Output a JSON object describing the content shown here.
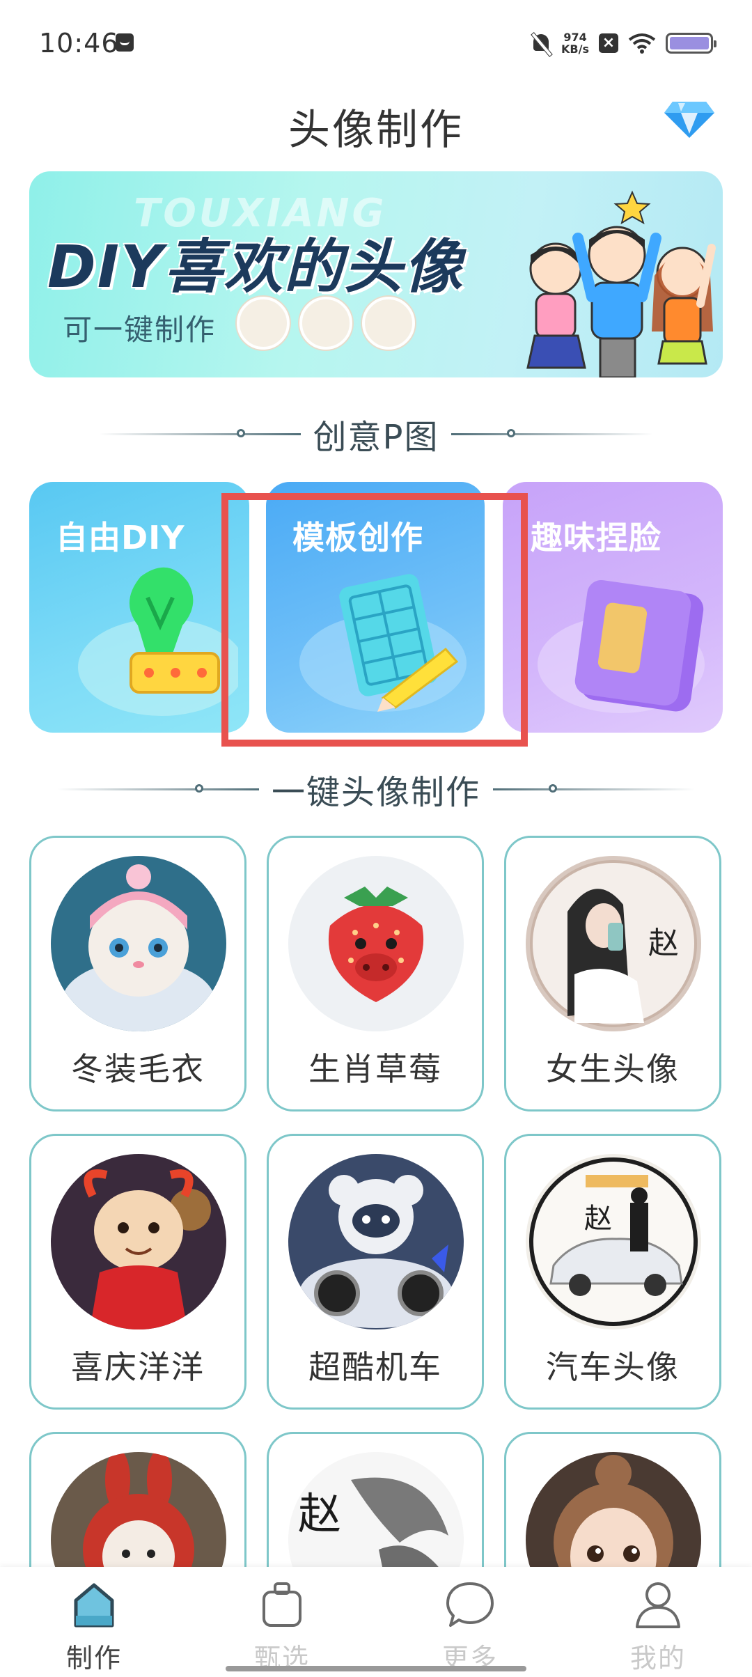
{
  "status_bar": {
    "time": "10:46",
    "net_speed_value": "974",
    "net_speed_unit": "KB/s"
  },
  "header": {
    "title": "头像制作",
    "vip_icon": "diamond-icon"
  },
  "banner": {
    "watermark": "TOUXIANG",
    "title": "DIY喜欢的头像",
    "subtitle": "可一键制作"
  },
  "creative_section": {
    "title": "创意P图",
    "cards": [
      {
        "label": "自由DIY",
        "icon": "bulb-stamp-icon"
      },
      {
        "label": "模板创作",
        "icon": "template-pencil-icon"
      },
      {
        "label": "趣味捏脸",
        "icon": "notebook-icon"
      }
    ]
  },
  "oneclick_section": {
    "title": "一键头像制作",
    "items": [
      {
        "label": "冬装毛衣"
      },
      {
        "label": "生肖草莓"
      },
      {
        "label": "女生头像"
      },
      {
        "label": "喜庆洋洋"
      },
      {
        "label": "超酷机车"
      },
      {
        "label": "汽车头像"
      },
      {
        "label": ""
      },
      {
        "label": ""
      },
      {
        "label": ""
      }
    ]
  },
  "bottom_nav": {
    "items": [
      {
        "label": "制作",
        "icon": "home-icon",
        "active": true
      },
      {
        "label": "甄选",
        "icon": "bag-icon",
        "active": false
      },
      {
        "label": "更多",
        "icon": "chat-bubble-icon",
        "active": false
      },
      {
        "label": "我的",
        "icon": "user-icon",
        "active": false
      }
    ]
  },
  "colors": {
    "accent_teal": "#7ec7c9",
    "highlight_red": "#e8524e",
    "nav_active": "#444444",
    "nav_inactive": "#c9c9c9"
  }
}
